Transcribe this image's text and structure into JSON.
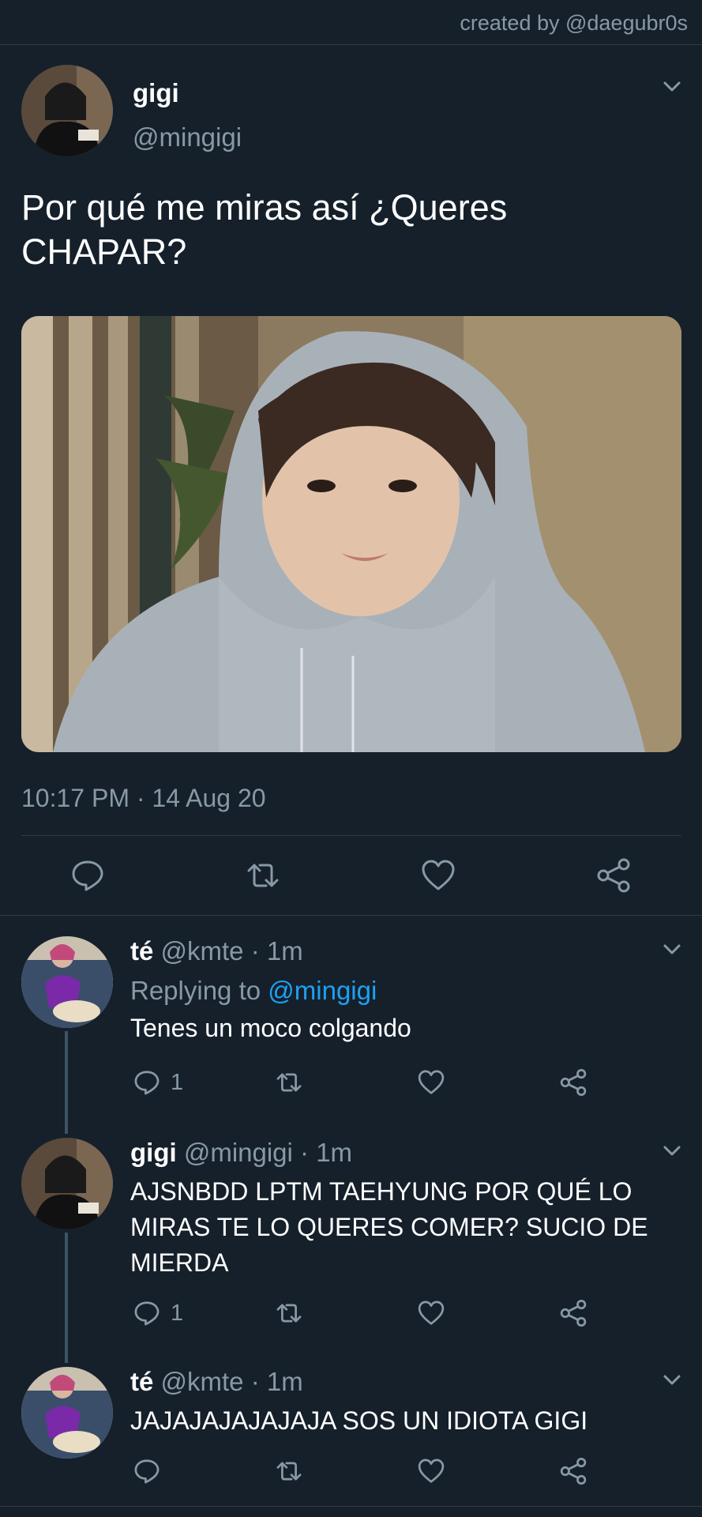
{
  "credit": "created by @daegubr0s",
  "main_tweet": {
    "name": "gigi",
    "handle": "@mingigi",
    "text": "Por qué me miras así ¿Queres CHAPAR?",
    "timestamp": "10:17 PM · 14 Aug 20"
  },
  "replies": [
    {
      "name": "té",
      "handle": "@kmte",
      "time": "· 1m",
      "replying_prefix": "Replying to",
      "replying_mention": "@mingigi",
      "text": "Tenes un moco colgando",
      "reply_count": "1"
    },
    {
      "name": "gigi",
      "handle": "@mingigi",
      "time": "· 1m",
      "text": "AJSNBDD LPTM TAEHYUNG POR QUÉ LO MIRAS TE LO QUERES COMER? SUCIO DE MIERDA",
      "reply_count": "1"
    },
    {
      "name": "té",
      "handle": "@kmte",
      "time": "· 1m",
      "text": "JAJAJAJAJAJAJA SOS UN IDIOTA GIGI",
      "reply_count": ""
    }
  ],
  "icons": {
    "reply": "speech-bubble-icon",
    "retweet": "retweet-icon",
    "like": "heart-icon",
    "share": "share-icon",
    "more": "chevron-down-icon"
  },
  "colors": {
    "background": "#15202b",
    "secondary_text": "#8899a6",
    "mention": "#1da1f2",
    "divider": "#2f3b47"
  }
}
